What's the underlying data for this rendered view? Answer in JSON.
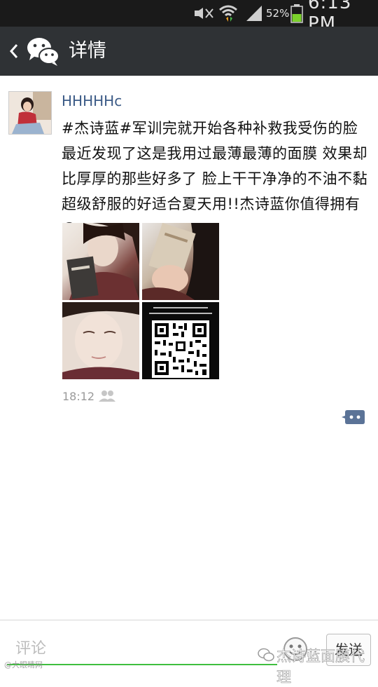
{
  "status_bar": {
    "battery_percent": "52%",
    "time": "6:13 PM",
    "battery_level": 0.52,
    "icons": [
      "mute-icon",
      "wifi-icon",
      "signal-icon",
      "battery-icon"
    ]
  },
  "header": {
    "title": "详情",
    "icons": [
      "back-icon",
      "wechat-logo-icon"
    ]
  },
  "post": {
    "username": "HHHHHc",
    "text": "#杰诗蓝#军训完就开始各种补救我受伤的脸最近发现了这是我用过最薄最薄的面膜 效果却比厚厚的那些好多了 脸上干干净净的不油不黏超级舒服的好适合夏天用!!杰诗蓝你值得拥有😌",
    "photos": [
      "photo-selfie-mask-box",
      "photo-mask-pack",
      "photo-face-closeup",
      "photo-qr-code"
    ],
    "time": "18:12",
    "visibility_icon": "friends-icon",
    "comment_icon": "comment-bubble-icon"
  },
  "composer": {
    "placeholder": "评论",
    "send_label": "发送",
    "emoji_icon": "emoji-icon"
  },
  "watermarks": {
    "left": "@大眼睛网",
    "right": "杰诗蓝面膜代理"
  },
  "colors": {
    "status_bg": "#1a1a1a",
    "header_bg": "#2f3235",
    "username": "#3b5a86",
    "input_underline": "#3fbf3f",
    "timestamp": "#9a9a9a"
  }
}
